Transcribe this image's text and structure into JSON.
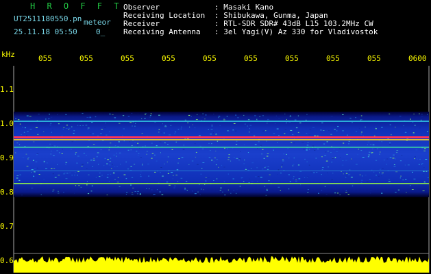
{
  "header": {
    "brand": "H R O F F T",
    "filename": "UT2511180550.pn",
    "type_label": "meteor",
    "datetime": "25.11.18 05:50",
    "extra": "0_",
    "info": [
      {
        "label": "Observer",
        "value": ": Masaki Kano"
      },
      {
        "label": "Receiving Location",
        "value": ": Shibukawa, Gunma, Japan"
      },
      {
        "label": "Receiver",
        "value": ": RTL-SDR SDR# 43dB L15 103.2MHz CW"
      },
      {
        "label": "Receiving Antenna",
        "value": ": 3el Yagi(V) Az 330 for Vladivostok"
      }
    ]
  },
  "axes": {
    "unit_label": "kHz",
    "time_ticks": [
      "055",
      "055",
      "055",
      "055",
      "055",
      "055",
      "055",
      "055",
      "055",
      "0600"
    ],
    "freq_ticks": [
      "1.1",
      "1.0",
      "0.9",
      "0.8",
      "0.7",
      "0.6"
    ]
  },
  "colors": {
    "text_cyan": "#79d7e8",
    "axis_yellow": "#ffff00",
    "brand_green": "#22cc44",
    "background": "#000000"
  }
}
